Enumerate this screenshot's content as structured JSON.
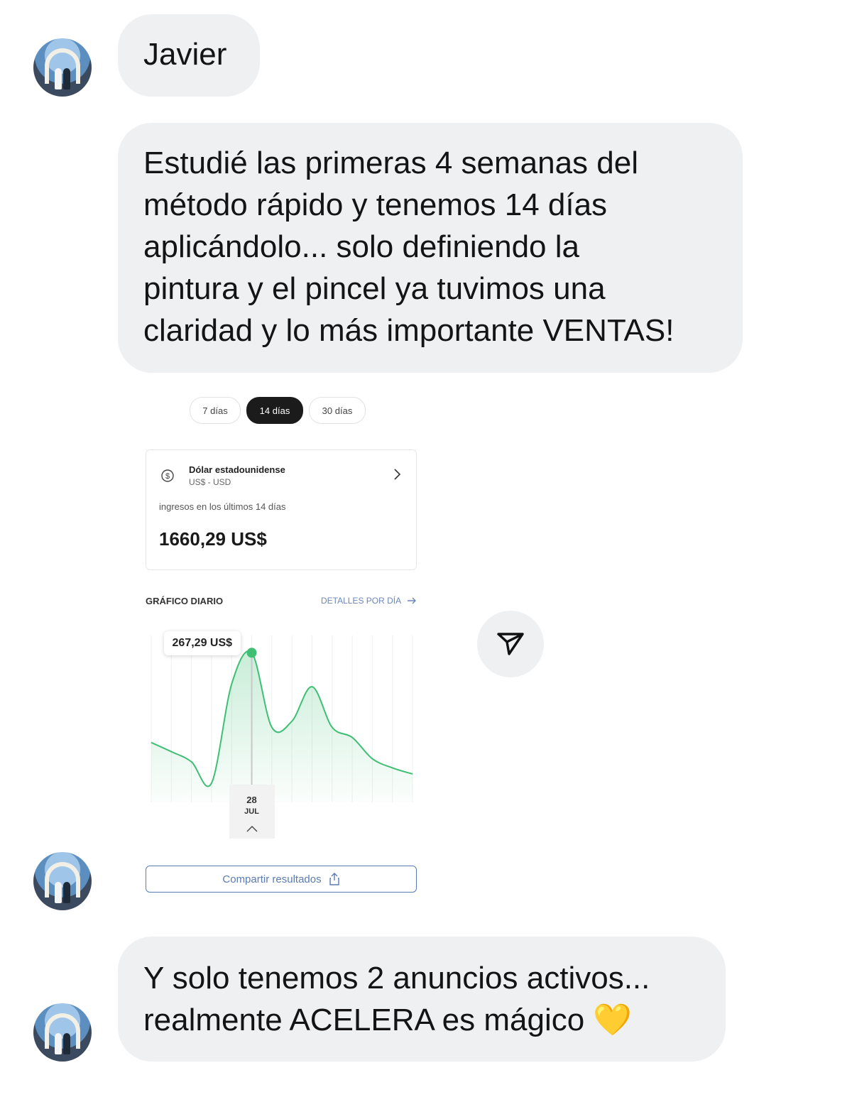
{
  "conversation": {
    "sender_name": "Javier",
    "message_1": "Estudié las primeras 4 semanas del\nmétodo rápido y tenemos 14 días\naplicándolo... solo definiendo la\npintura y el pincel ya tuvimos una\nclaridad y lo más importante VENTAS!",
    "message_2": "Y solo tenemos 2 anuncios activos...\nrealmente ACELERA es mágico 💛"
  },
  "shared_screenshot": {
    "period_tabs": [
      "7 días",
      "14 días",
      "30 días"
    ],
    "selected_period": "14 días",
    "currency_name": "Dólar estadounidense",
    "currency_code": "US$ - USD",
    "income_label": "ingresos en los últimos 14 días",
    "income_total": "1660,29 US$",
    "chart_section_title": "GRÁFICO DIARIO",
    "details_link": "DETALLES POR DÍA",
    "tooltip_value": "267,29 US$",
    "selected_day": "28",
    "selected_month": "JUL",
    "share_button_label": "Compartir resultados"
  },
  "colors": {
    "bubble_bg": "#eff0f2",
    "line_green": "#3fbf74",
    "share_blue": "#5a7bb4",
    "selected_pill": "#1b1b1b"
  },
  "icons": [
    "dollar-icon",
    "chevron-right-icon",
    "arrow-right-icon",
    "chevron-up-icon",
    "share-icon",
    "send-icon",
    "yellow-heart-emoji"
  ],
  "chart_data": {
    "type": "area",
    "title": "GRÁFICO DIARIO",
    "xlabel": "",
    "ylabel": "",
    "x": [
      1,
      2,
      3,
      4,
      5,
      6,
      7,
      8,
      9,
      10,
      11,
      12,
      13,
      14
    ],
    "highlight": {
      "x": 6,
      "label": "28 JUL",
      "value": 267.29
    },
    "series": [
      {
        "values": [
          90,
          72,
          52,
          10,
          205,
          267,
          120,
          132,
          200,
          120,
          100,
          58,
          40,
          28
        ]
      }
    ],
    "grid": "vertical"
  }
}
